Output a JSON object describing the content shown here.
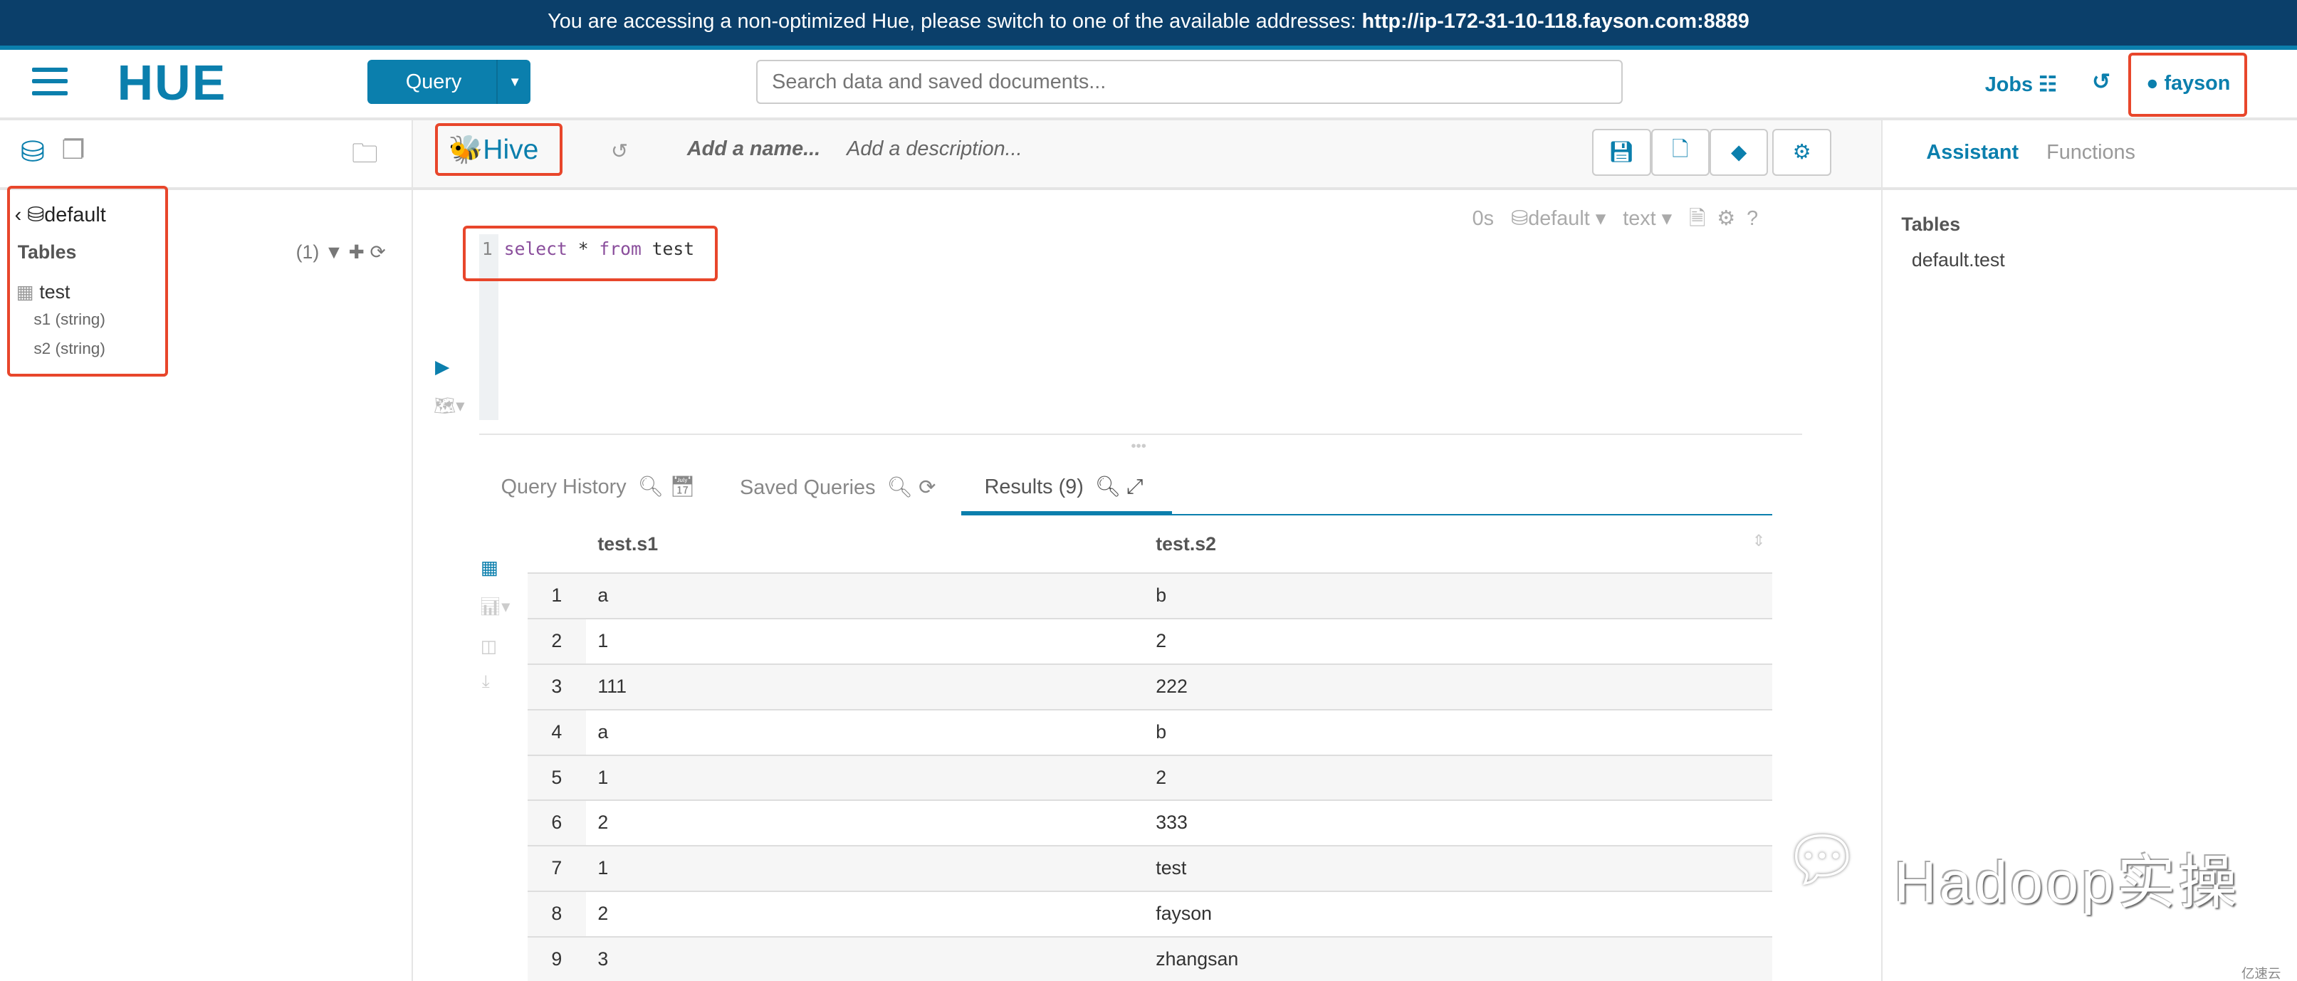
{
  "banner": {
    "text": "You are accessing a non-optimized Hue, please switch to one of the available addresses: ",
    "url": "http://ip-172-31-10-118.fayson.com:8889"
  },
  "header": {
    "logo": "HUE",
    "query_button": "Query",
    "search_placeholder": "Search data and saved documents...",
    "jobs": "Jobs",
    "user": "fayson"
  },
  "left": {
    "database": "default",
    "tables_label": "Tables",
    "count": "(1)",
    "table": "test",
    "columns": [
      "s1 (string)",
      "s2 (string)"
    ]
  },
  "editor": {
    "type": "Hive",
    "name_placeholder": "Add a name...",
    "description_placeholder": "Add a description...",
    "elapsed": "0s",
    "database": "default",
    "format": "text",
    "line_number": "1",
    "code": {
      "kw1": "select",
      "mid": " * ",
      "kw2": "from",
      "rest": " test"
    }
  },
  "tabs": {
    "history": "Query History",
    "saved": "Saved Queries",
    "results": "Results (9)"
  },
  "results": {
    "headers": [
      "test.s1",
      "test.s2"
    ],
    "rows": [
      [
        "1",
        "a",
        "b"
      ],
      [
        "2",
        "1",
        "2"
      ],
      [
        "3",
        "111",
        "222"
      ],
      [
        "4",
        "a",
        "b"
      ],
      [
        "5",
        "1",
        "2"
      ],
      [
        "6",
        "2",
        "333"
      ],
      [
        "7",
        "1",
        "test"
      ],
      [
        "8",
        "2",
        "fayson"
      ],
      [
        "9",
        "3",
        "zhangsan"
      ]
    ]
  },
  "right": {
    "tab_assistant": "Assistant",
    "tab_functions": "Functions",
    "tables_label": "Tables",
    "table": "default.test"
  },
  "watermark": {
    "text": "Hadoop实操",
    "corner": "亿速云"
  },
  "colors": {
    "brand": "#0b7fad",
    "banner": "#0b3f6a",
    "highlight": "#e8462b"
  }
}
